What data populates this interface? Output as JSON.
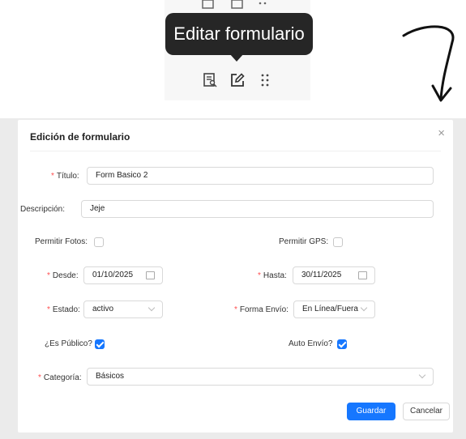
{
  "tooltip": {
    "text": "Editar formulario"
  },
  "toolbar": {
    "icons": [
      "form-view-icon",
      "edit-form-icon",
      "drag-handle-icon"
    ]
  },
  "modal": {
    "title": "Edición de formulario",
    "close": "×",
    "required_mark": "*",
    "fields": {
      "titulo": {
        "label": "Título:",
        "value": "Form Basico 2"
      },
      "descripcion": {
        "label": "Descripción:",
        "value": "Jeje"
      },
      "permitir_fotos": {
        "label": "Permitir Fotos:",
        "checked": false
      },
      "permitir_gps": {
        "label": "Permitir GPS:",
        "checked": false
      },
      "desde": {
        "label": "Desde:",
        "value": "01/10/2025"
      },
      "hasta": {
        "label": "Hasta:",
        "value": "30/11/2025"
      },
      "estado": {
        "label": "Estado:",
        "value": "activo"
      },
      "forma_envio": {
        "label": "Forma Envío:",
        "value": "En Línea/Fuera"
      },
      "es_publico": {
        "label": "¿Es Público?",
        "checked": true
      },
      "auto_envio": {
        "label": "Auto Envío?",
        "checked": true
      },
      "categoria": {
        "label": "Categoría:",
        "value": "Básicos"
      }
    },
    "buttons": {
      "save": "Guardar",
      "cancel": "Cancelar"
    }
  },
  "colors": {
    "primary": "#1677ff",
    "required": "#ff4d4f",
    "tooltip_bg": "#262626"
  }
}
